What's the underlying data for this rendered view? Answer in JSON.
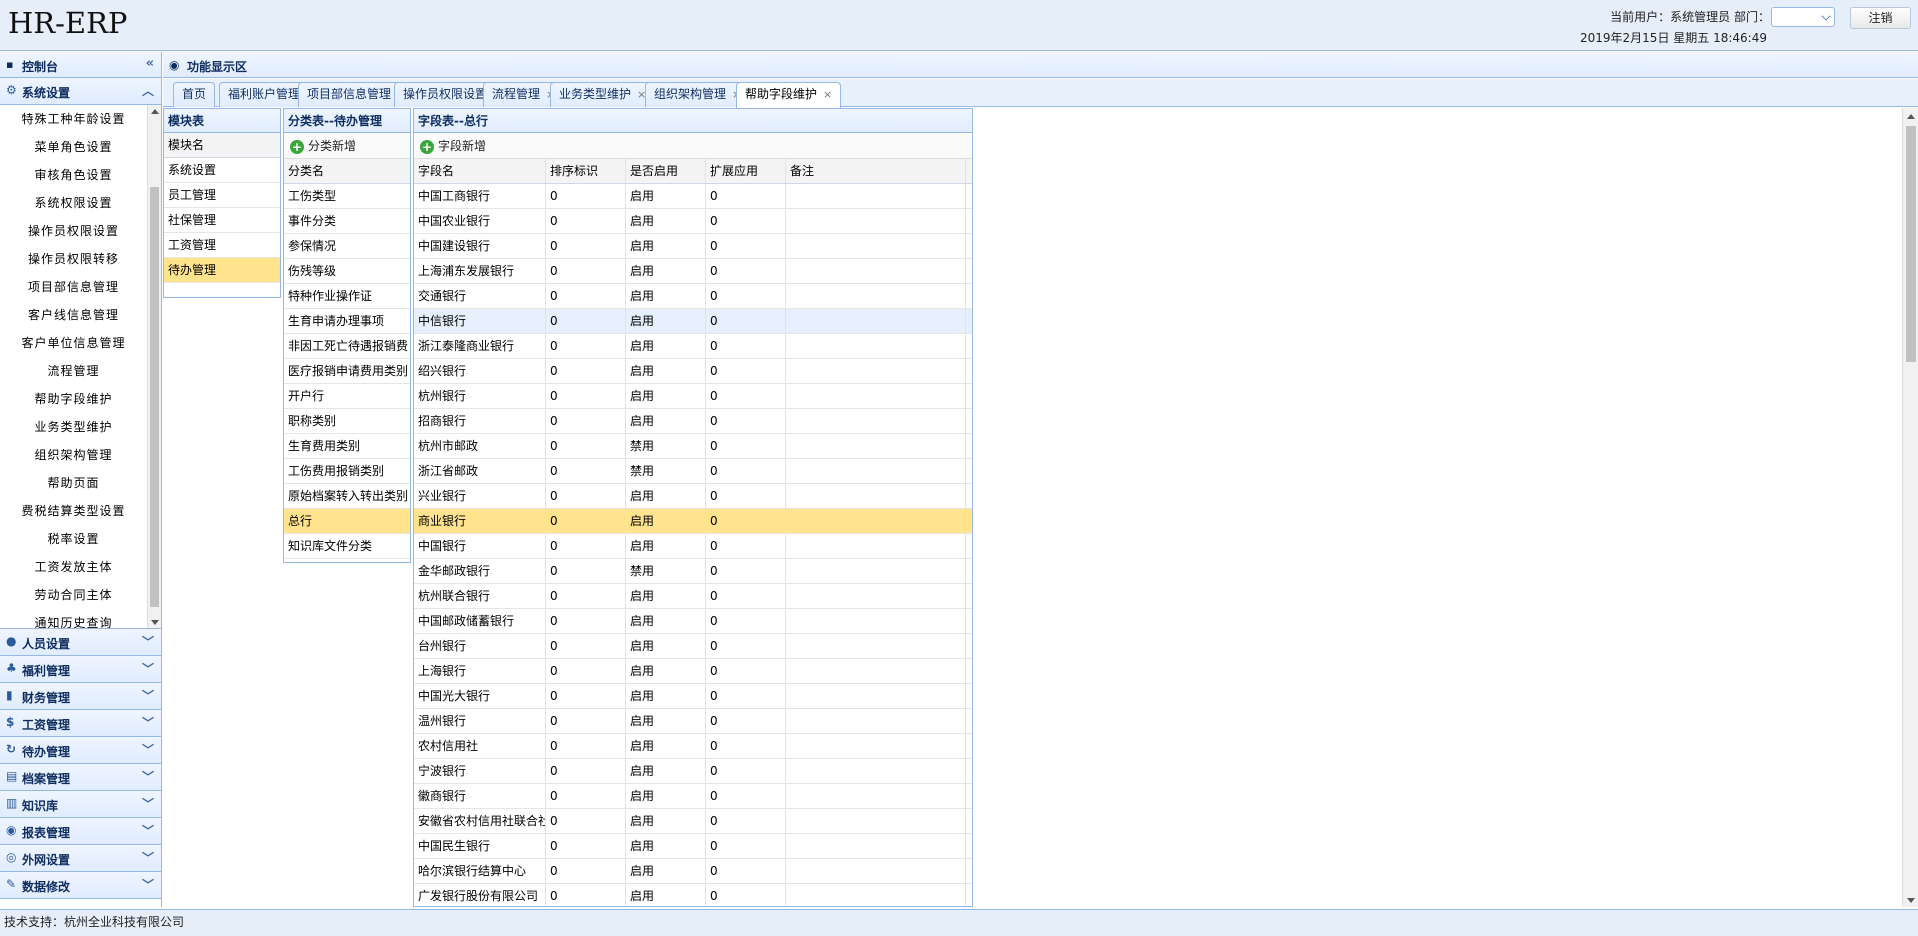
{
  "header": {
    "title": "HR-ERP",
    "user_line": "当前用户：系统管理员   部门：",
    "datetime": "2019年2月15日 星期五 18:46:49",
    "dept_value": "",
    "logout_label": "注销"
  },
  "sidebar": {
    "title": "控制台",
    "collapse_icon": "«",
    "active_group": "系统设置",
    "active_group_tool": "︿",
    "items": [
      "特殊工种年龄设置",
      "菜单角色设置",
      "审核角色设置",
      "系统权限设置",
      "操作员权限设置",
      "操作员权限转移",
      "项目部信息管理",
      "客户线信息管理",
      "客户单位信息管理",
      "流程管理",
      "帮助字段维护",
      "业务类型维护",
      "组织架构管理",
      "帮助页面",
      "费税结算类型设置",
      "税率设置",
      "工资发放主体",
      "劳动合同主体",
      "通知历史查询"
    ],
    "groups": [
      {
        "label": "人员设置",
        "icon": "person-icon",
        "glyph": "●"
      },
      {
        "label": "福利管理",
        "icon": "users-icon",
        "glyph": "♣"
      },
      {
        "label": "财务管理",
        "icon": "bar-chart-icon",
        "glyph": "▮"
      },
      {
        "label": "工资管理",
        "icon": "dollar-icon",
        "glyph": "$"
      },
      {
        "label": "待办管理",
        "icon": "todo-icon",
        "glyph": "↻"
      },
      {
        "label": "档案管理",
        "icon": "archive-icon",
        "glyph": "▤"
      },
      {
        "label": "知识库",
        "icon": "library-icon",
        "glyph": "▥"
      },
      {
        "label": "报表管理",
        "icon": "report-icon",
        "glyph": "◉"
      },
      {
        "label": "外网设置",
        "icon": "globe-icon",
        "glyph": "◎"
      },
      {
        "label": "数据修改",
        "icon": "edit-icon",
        "glyph": "✎"
      }
    ],
    "group_tool": "﹀"
  },
  "main": {
    "title": "功能显示区",
    "tabs": [
      {
        "label": "首页",
        "closable": false
      },
      {
        "label": "福利账户管理",
        "closable": true
      },
      {
        "label": "项目部信息管理",
        "closable": true
      },
      {
        "label": "操作员权限设置",
        "closable": true
      },
      {
        "label": "流程管理",
        "closable": true
      },
      {
        "label": "业务类型维护",
        "closable": true
      },
      {
        "label": "组织架构管理",
        "closable": true
      },
      {
        "label": "帮助字段维护",
        "closable": true,
        "active": true
      }
    ],
    "close_glyph": "×"
  },
  "module_panel": {
    "title": "模块表",
    "header": "模块名",
    "rows": [
      "系统设置",
      "员工管理",
      "社保管理",
      "工资管理",
      "待办管理"
    ],
    "selected_index": 4
  },
  "category_panel": {
    "title": "分类表--待办管理",
    "add_label": "分类新增",
    "header": "分类名",
    "rows": [
      "工伤类型",
      "事件分类",
      "参保情况",
      "伤残等级",
      "特种作业操作证",
      "生育申请办理事项",
      "非因工死亡待遇报销费",
      "医疗报销申请费用类别",
      "开户行",
      "职称类别",
      "生育费用类别",
      "工伤费用报销类别",
      "原始档案转入转出类别",
      "总行",
      "知识库文件分类"
    ],
    "selected_index": 13
  },
  "field_panel": {
    "title": "字段表--总行",
    "add_label": "字段新增",
    "columns": [
      "字段名",
      "排序标识",
      "是否启用",
      "扩展应用",
      "备注"
    ],
    "rows": [
      [
        "中国工商银行",
        "0",
        "启用",
        "0",
        ""
      ],
      [
        "中国农业银行",
        "0",
        "启用",
        "0",
        ""
      ],
      [
        "中国建设银行",
        "0",
        "启用",
        "0",
        ""
      ],
      [
        "上海浦东发展银行",
        "0",
        "启用",
        "0",
        ""
      ],
      [
        "交通银行",
        "0",
        "启用",
        "0",
        ""
      ],
      [
        "中信银行",
        "0",
        "启用",
        "0",
        ""
      ],
      [
        "浙江泰隆商业银行",
        "0",
        "启用",
        "0",
        ""
      ],
      [
        "绍兴银行",
        "0",
        "启用",
        "0",
        ""
      ],
      [
        "杭州银行",
        "0",
        "启用",
        "0",
        ""
      ],
      [
        "招商银行",
        "0",
        "启用",
        "0",
        ""
      ],
      [
        "杭州市邮政",
        "0",
        "禁用",
        "0",
        ""
      ],
      [
        "浙江省邮政",
        "0",
        "禁用",
        "0",
        ""
      ],
      [
        "兴业银行",
        "0",
        "启用",
        "0",
        ""
      ],
      [
        "商业银行",
        "0",
        "启用",
        "0",
        ""
      ],
      [
        "中国银行",
        "0",
        "启用",
        "0",
        ""
      ],
      [
        "金华邮政银行",
        "0",
        "禁用",
        "0",
        ""
      ],
      [
        "杭州联合银行",
        "0",
        "启用",
        "0",
        ""
      ],
      [
        "中国邮政储蓄银行",
        "0",
        "启用",
        "0",
        ""
      ],
      [
        "台州银行",
        "0",
        "启用",
        "0",
        ""
      ],
      [
        "上海银行",
        "0",
        "启用",
        "0",
        ""
      ],
      [
        "中国光大银行",
        "0",
        "启用",
        "0",
        ""
      ],
      [
        "温州银行",
        "0",
        "启用",
        "0",
        ""
      ],
      [
        "农村信用社",
        "0",
        "启用",
        "0",
        ""
      ],
      [
        "宁波银行",
        "0",
        "启用",
        "0",
        ""
      ],
      [
        "徽商银行",
        "0",
        "启用",
        "0",
        ""
      ],
      [
        "安徽省农村信用社联合社",
        "0",
        "启用",
        "0",
        ""
      ],
      [
        "中国民生银行",
        "0",
        "启用",
        "0",
        ""
      ],
      [
        "哈尔滨银行结算中心",
        "0",
        "启用",
        "0",
        ""
      ],
      [
        "广发银行股份有限公司",
        "0",
        "启用",
        "0",
        ""
      ]
    ],
    "selected_index": 13,
    "hover_index": 5
  },
  "footer": {
    "text": "技术支持：杭州全业科技有限公司"
  }
}
